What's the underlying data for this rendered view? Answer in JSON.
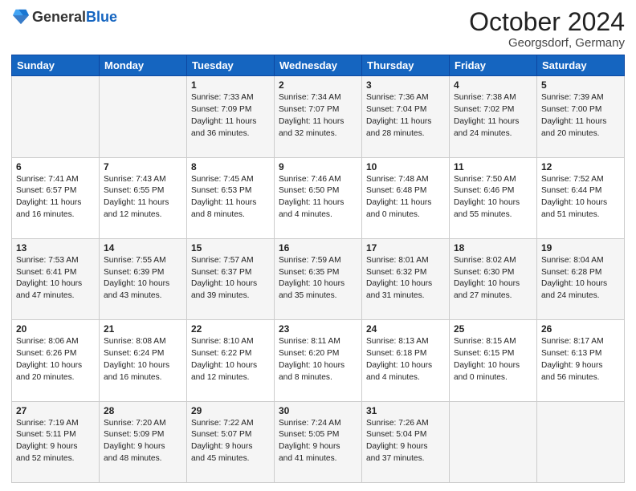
{
  "header": {
    "logo_general": "General",
    "logo_blue": "Blue",
    "month": "October 2024",
    "location": "Georgsdorf, Germany"
  },
  "weekdays": [
    "Sunday",
    "Monday",
    "Tuesday",
    "Wednesday",
    "Thursday",
    "Friday",
    "Saturday"
  ],
  "weeks": [
    [
      {
        "day": "",
        "detail": ""
      },
      {
        "day": "",
        "detail": ""
      },
      {
        "day": "1",
        "detail": "Sunrise: 7:33 AM\nSunset: 7:09 PM\nDaylight: 11 hours\nand 36 minutes."
      },
      {
        "day": "2",
        "detail": "Sunrise: 7:34 AM\nSunset: 7:07 PM\nDaylight: 11 hours\nand 32 minutes."
      },
      {
        "day": "3",
        "detail": "Sunrise: 7:36 AM\nSunset: 7:04 PM\nDaylight: 11 hours\nand 28 minutes."
      },
      {
        "day": "4",
        "detail": "Sunrise: 7:38 AM\nSunset: 7:02 PM\nDaylight: 11 hours\nand 24 minutes."
      },
      {
        "day": "5",
        "detail": "Sunrise: 7:39 AM\nSunset: 7:00 PM\nDaylight: 11 hours\nand 20 minutes."
      }
    ],
    [
      {
        "day": "6",
        "detail": "Sunrise: 7:41 AM\nSunset: 6:57 PM\nDaylight: 11 hours\nand 16 minutes."
      },
      {
        "day": "7",
        "detail": "Sunrise: 7:43 AM\nSunset: 6:55 PM\nDaylight: 11 hours\nand 12 minutes."
      },
      {
        "day": "8",
        "detail": "Sunrise: 7:45 AM\nSunset: 6:53 PM\nDaylight: 11 hours\nand 8 minutes."
      },
      {
        "day": "9",
        "detail": "Sunrise: 7:46 AM\nSunset: 6:50 PM\nDaylight: 11 hours\nand 4 minutes."
      },
      {
        "day": "10",
        "detail": "Sunrise: 7:48 AM\nSunset: 6:48 PM\nDaylight: 11 hours\nand 0 minutes."
      },
      {
        "day": "11",
        "detail": "Sunrise: 7:50 AM\nSunset: 6:46 PM\nDaylight: 10 hours\nand 55 minutes."
      },
      {
        "day": "12",
        "detail": "Sunrise: 7:52 AM\nSunset: 6:44 PM\nDaylight: 10 hours\nand 51 minutes."
      }
    ],
    [
      {
        "day": "13",
        "detail": "Sunrise: 7:53 AM\nSunset: 6:41 PM\nDaylight: 10 hours\nand 47 minutes."
      },
      {
        "day": "14",
        "detail": "Sunrise: 7:55 AM\nSunset: 6:39 PM\nDaylight: 10 hours\nand 43 minutes."
      },
      {
        "day": "15",
        "detail": "Sunrise: 7:57 AM\nSunset: 6:37 PM\nDaylight: 10 hours\nand 39 minutes."
      },
      {
        "day": "16",
        "detail": "Sunrise: 7:59 AM\nSunset: 6:35 PM\nDaylight: 10 hours\nand 35 minutes."
      },
      {
        "day": "17",
        "detail": "Sunrise: 8:01 AM\nSunset: 6:32 PM\nDaylight: 10 hours\nand 31 minutes."
      },
      {
        "day": "18",
        "detail": "Sunrise: 8:02 AM\nSunset: 6:30 PM\nDaylight: 10 hours\nand 27 minutes."
      },
      {
        "day": "19",
        "detail": "Sunrise: 8:04 AM\nSunset: 6:28 PM\nDaylight: 10 hours\nand 24 minutes."
      }
    ],
    [
      {
        "day": "20",
        "detail": "Sunrise: 8:06 AM\nSunset: 6:26 PM\nDaylight: 10 hours\nand 20 minutes."
      },
      {
        "day": "21",
        "detail": "Sunrise: 8:08 AM\nSunset: 6:24 PM\nDaylight: 10 hours\nand 16 minutes."
      },
      {
        "day": "22",
        "detail": "Sunrise: 8:10 AM\nSunset: 6:22 PM\nDaylight: 10 hours\nand 12 minutes."
      },
      {
        "day": "23",
        "detail": "Sunrise: 8:11 AM\nSunset: 6:20 PM\nDaylight: 10 hours\nand 8 minutes."
      },
      {
        "day": "24",
        "detail": "Sunrise: 8:13 AM\nSunset: 6:18 PM\nDaylight: 10 hours\nand 4 minutes."
      },
      {
        "day": "25",
        "detail": "Sunrise: 8:15 AM\nSunset: 6:15 PM\nDaylight: 10 hours\nand 0 minutes."
      },
      {
        "day": "26",
        "detail": "Sunrise: 8:17 AM\nSunset: 6:13 PM\nDaylight: 9 hours\nand 56 minutes."
      }
    ],
    [
      {
        "day": "27",
        "detail": "Sunrise: 7:19 AM\nSunset: 5:11 PM\nDaylight: 9 hours\nand 52 minutes."
      },
      {
        "day": "28",
        "detail": "Sunrise: 7:20 AM\nSunset: 5:09 PM\nDaylight: 9 hours\nand 48 minutes."
      },
      {
        "day": "29",
        "detail": "Sunrise: 7:22 AM\nSunset: 5:07 PM\nDaylight: 9 hours\nand 45 minutes."
      },
      {
        "day": "30",
        "detail": "Sunrise: 7:24 AM\nSunset: 5:05 PM\nDaylight: 9 hours\nand 41 minutes."
      },
      {
        "day": "31",
        "detail": "Sunrise: 7:26 AM\nSunset: 5:04 PM\nDaylight: 9 hours\nand 37 minutes."
      },
      {
        "day": "",
        "detail": ""
      },
      {
        "day": "",
        "detail": ""
      }
    ]
  ]
}
